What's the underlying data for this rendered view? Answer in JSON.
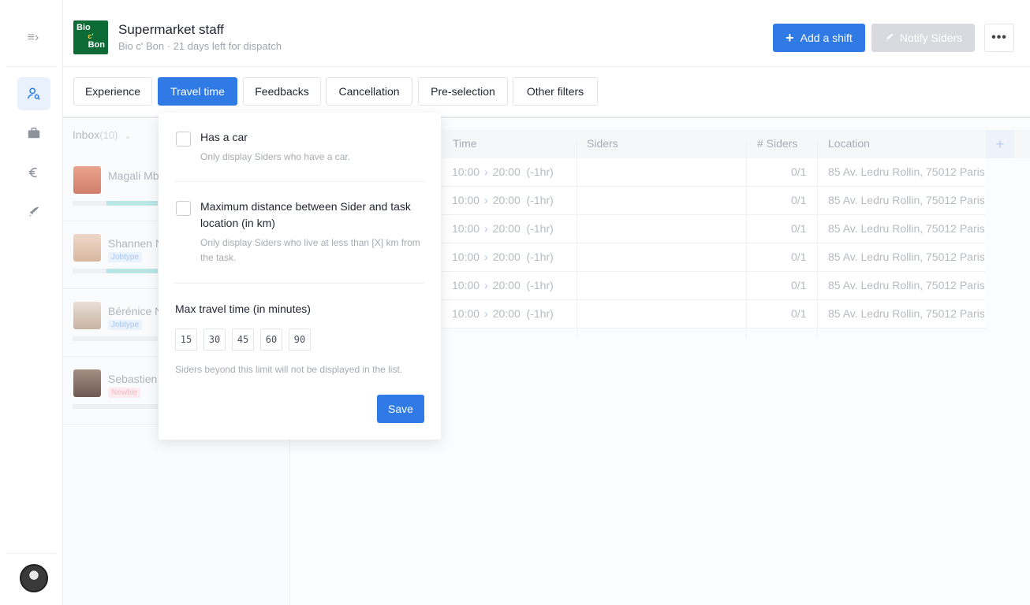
{
  "header": {
    "logo_lines": [
      "Bio",
      "c'",
      "Bon"
    ],
    "title": "Supermarket staff",
    "subtitle": "Bio c' Bon · 21 days left for dispatch",
    "add_shift_label": "Add a shift",
    "notify_label": "Notify Siders",
    "more_label": "•••"
  },
  "sidebar": {
    "collapse_icon": "collapse-menu-icon",
    "items": [
      {
        "icon": "user-search-icon",
        "active": true
      },
      {
        "icon": "briefcase-icon",
        "active": false
      },
      {
        "icon": "euro-icon",
        "active": false
      },
      {
        "icon": "rocket-icon",
        "active": false
      }
    ]
  },
  "filters": [
    {
      "label": "Experience",
      "active": false
    },
    {
      "label": "Travel time",
      "active": true
    },
    {
      "label": "Feedbacks",
      "active": false
    },
    {
      "label": "Cancellation",
      "active": false
    },
    {
      "label": "Pre-selection",
      "active": false
    },
    {
      "label": "Other filters",
      "active": false
    }
  ],
  "inbox": {
    "label": "Inbox",
    "count": "(10)",
    "siders": [
      {
        "name": "Magali Mb",
        "tag": ""
      },
      {
        "name": "Shannen N",
        "tag": "Jobtype"
      },
      {
        "name": "Bérénice N",
        "tag": "Jobtype"
      },
      {
        "name": "Sebastien",
        "tag": "Newbie"
      }
    ]
  },
  "table": {
    "columns": [
      "Time",
      "Siders",
      "# Siders",
      "Location"
    ],
    "rows": [
      {
        "start": "10:00",
        "end": "20:00",
        "break": "(-1hr)",
        "siders": "",
        "count": "0/1",
        "location": "85 Av. Ledru Rollin, 75012 Paris"
      },
      {
        "start": "10:00",
        "end": "20:00",
        "break": "(-1hr)",
        "siders": "",
        "count": "0/1",
        "location": "85 Av. Ledru Rollin, 75012 Paris"
      },
      {
        "start": "10:00",
        "end": "20:00",
        "break": "(-1hr)",
        "siders": "",
        "count": "0/1",
        "location": "85 Av. Ledru Rollin, 75012 Paris"
      },
      {
        "start": "10:00",
        "end": "20:00",
        "break": "(-1hr)",
        "siders": "",
        "count": "0/1",
        "location": "85 Av. Ledru Rollin, 75012 Paris"
      },
      {
        "start": "10:00",
        "end": "20:00",
        "break": "(-1hr)",
        "siders": "",
        "count": "0/1",
        "location": "85 Av. Ledru Rollin, 75012 Paris"
      },
      {
        "start": "10:00",
        "end": "20:00",
        "break": "(-1hr)",
        "siders": "",
        "count": "0/1",
        "location": "85 Av. Ledru Rollin, 75012 Paris"
      }
    ]
  },
  "popover": {
    "has_car_title": "Has a car",
    "has_car_desc": "Only display Siders who have a car.",
    "max_distance_title": "Maximum distance between Sider and task location (in km)",
    "max_distance_desc": "Only display Siders who live at less than [X] km from the task.",
    "max_travel_title": "Max travel time (in minutes)",
    "travel_options": [
      "15",
      "30",
      "45",
      "60",
      "90"
    ],
    "hint": "Siders beyond this limit will not be displayed in the list.",
    "save_label": "Save"
  },
  "colors": {
    "primary": "#2f7ae5",
    "disabled": "#d7dbe0",
    "logo_green": "#0c6b34"
  }
}
